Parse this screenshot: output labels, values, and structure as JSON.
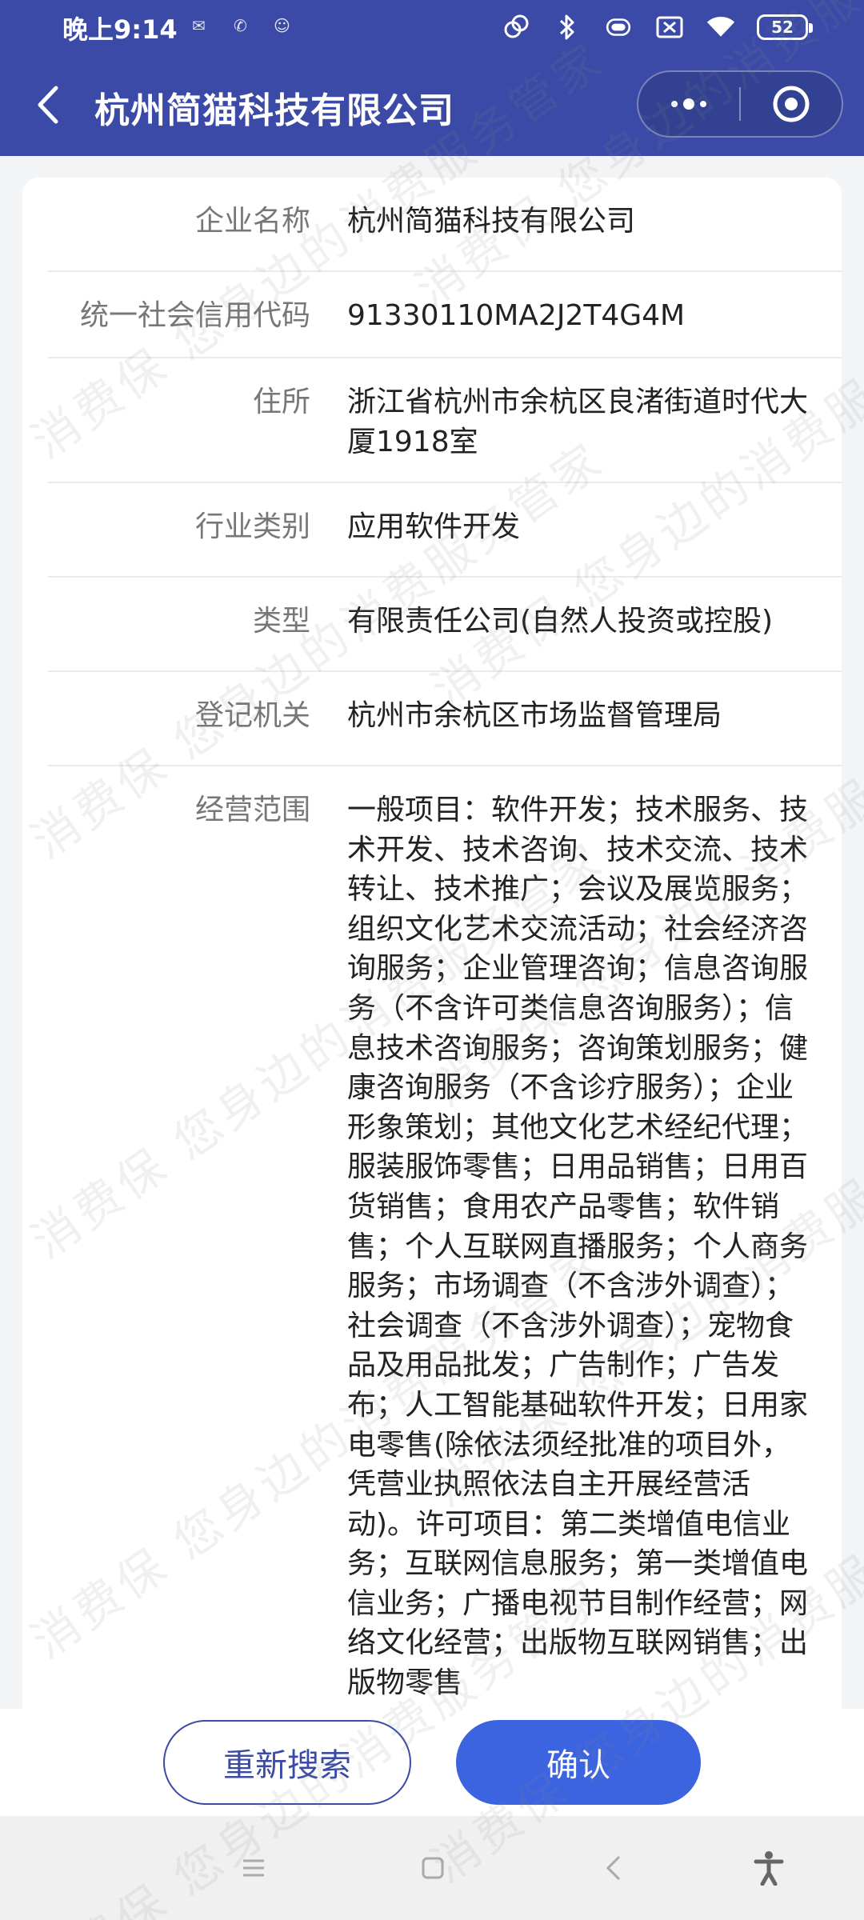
{
  "status_bar": {
    "time": "晚上9:14",
    "battery": "52",
    "notification_icons": [
      "app-notification-icon",
      "app-notification-icon",
      "app-notification-icon"
    ],
    "right_icons": [
      "nfc-icon",
      "bluetooth-icon",
      "vibrate-icon",
      "sim-card-icon",
      "wifi-icon",
      "battery-icon"
    ]
  },
  "nav": {
    "title": "杭州简猫科技有限公司",
    "back_icon": "chevron-left-icon",
    "more_icon": "more-dots-icon",
    "close_icon": "target-circle-icon"
  },
  "company": {
    "rows": [
      {
        "label": "企业名称",
        "value": "杭州简猫科技有限公司"
      },
      {
        "label": "统一社会信用代码",
        "value": "91330110MA2J2T4G4M"
      },
      {
        "label": "住所",
        "value": "浙江省杭州市余杭区良渚街道时代大厦1918室"
      },
      {
        "label": "行业类别",
        "value": "应用软件开发"
      },
      {
        "label": "类型",
        "value": "有限责任公司(自然人投资或控股)"
      },
      {
        "label": "登记机关",
        "value": "杭州市余杭区市场监督管理局"
      },
      {
        "label": "经营范围",
        "value": "一般项目：软件开发；技术服务、技术开发、技术咨询、技术交流、技术转让、技术推广；会议及展览服务；组织文化艺术交流活动；社会经济咨询服务；企业管理咨询；信息咨询服务（不含许可类信息咨询服务）；信息技术咨询服务；咨询策划服务；健康咨询服务（不含诊疗服务）；企业形象策划；其他文化艺术经纪代理；服装服饰零售；日用品销售；日用百货销售；食用农产品零售；软件销售；个人互联网直播服务；个人商务服务；市场调查（不含涉外调查）；社会调查（不含涉外调查）；宠物食品及用品批发；广告制作；广告发布；人工智能基础软件开发；日用家电零售(除依法须经批准的项目外，凭营业执照依法自主开展经营活动)。许可项目：第二类增值电信业务；互联网信息服务；第一类增值电信业务；广播电视节目制作经营；网络文化经营；出版物互联网销售；出版物零售"
      }
    ]
  },
  "actions": {
    "research_label": "重新搜索",
    "confirm_label": "确认"
  },
  "system_nav": {
    "menu_icon": "menu-icon",
    "home_icon": "home-square-icon",
    "back_icon": "back-chevron-icon",
    "accessibility_icon": "accessibility-icon"
  },
  "watermark": {
    "text": "消费保 您身边的消费服务管家"
  },
  "colors": {
    "header_bg": "#3a4aa6",
    "primary": "#3c63e0",
    "label": "#777777",
    "value": "#222222"
  }
}
